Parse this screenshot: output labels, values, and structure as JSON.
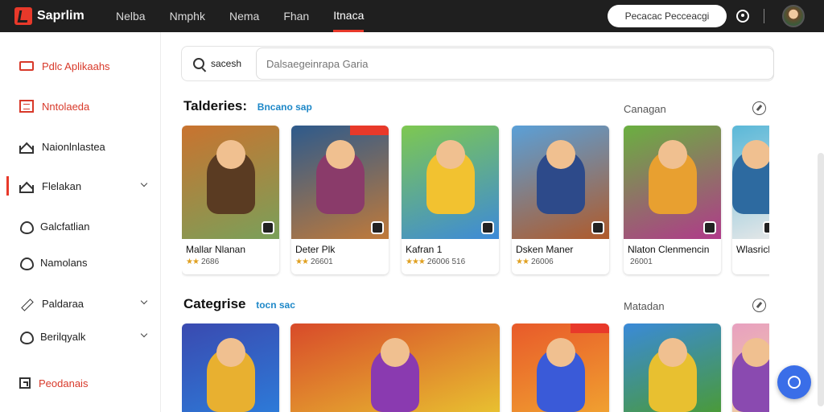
{
  "app": {
    "name": "Saprlim"
  },
  "topnav": {
    "items": [
      "Nelba",
      "Nmphk",
      "Nema",
      "Fhan",
      "Itnaca"
    ],
    "active_index": 4
  },
  "topbar": {
    "search_label": "Pecacac Pecceacgi"
  },
  "sidebar": {
    "items": [
      {
        "label": "Pdlc Aplikaahs",
        "icon": "monitor-icon",
        "color": "#d8392a",
        "chevron": false
      },
      {
        "label": "Nntolaeda",
        "icon": "list-icon",
        "color": "#d8392a",
        "chevron": false
      },
      {
        "label": "Naionlnlastea",
        "icon": "home-icon",
        "color": "#222222",
        "chevron": false
      },
      {
        "label": "Flelakan",
        "icon": "home-icon",
        "color": "#222222",
        "chevron": true,
        "current": true
      },
      {
        "label": "Galcfatlian",
        "icon": "heart-icon",
        "color": "#222222",
        "chevron": false
      },
      {
        "label": "Namolans",
        "icon": "heart-icon",
        "color": "#222222",
        "chevron": false
      },
      {
        "label": "Paldaraa",
        "icon": "pencil-icon",
        "color": "#222222",
        "chevron": true
      },
      {
        "label": "Berilqyalk",
        "icon": "heart-icon",
        "color": "#222222",
        "chevron": true
      },
      {
        "label": "Peodanais",
        "icon": "box-icon",
        "color": "#d8392a",
        "chevron": false
      }
    ]
  },
  "search": {
    "label": "sacesh",
    "placeholder": "Dalsaegeinrapa Garia"
  },
  "section1": {
    "title": "Talderies:",
    "subtitle": "Bncano sap",
    "right_label": "Canagan",
    "cards": [
      {
        "name": "Mallar Nlanan",
        "stars": "★★",
        "meta": "2686",
        "colors": [
          "#c9732f",
          "#5a3b22",
          "#7aa05a"
        ],
        "tag": false
      },
      {
        "name": "Deter Plk",
        "stars": "★★",
        "meta": "26601",
        "colors": [
          "#2d5a8c",
          "#8a3b6a",
          "#c07a3a"
        ],
        "tag": true
      },
      {
        "name": "Kafran 1",
        "stars": "★★★",
        "meta": "26006 516",
        "colors": [
          "#7ec850",
          "#f2c230",
          "#3d8ad8"
        ],
        "tag": false
      },
      {
        "name": "Dsken Maner",
        "stars": "★★",
        "meta": "26006",
        "colors": [
          "#5aa0d8",
          "#2d4a8a",
          "#b05a2a"
        ],
        "tag": false
      },
      {
        "name": "Nlaton Clenmencin",
        "stars": "",
        "meta": "26001",
        "colors": [
          "#6ab040",
          "#e8a030",
          "#b03a8a"
        ],
        "tag": false
      },
      {
        "name": "Wlasrich",
        "stars": "",
        "meta": "",
        "colors": [
          "#5ab8d8",
          "#2d6aa0",
          "#e8e8e8"
        ],
        "tag": false
      }
    ]
  },
  "section2": {
    "title": "Categrise",
    "subtitle": "tocn sac",
    "right_label": "Matadan",
    "cards": [
      {
        "name": "",
        "colors": [
          "#3a4ab0",
          "#e8b030",
          "#2d7ad8"
        ],
        "tag": false
      },
      {
        "name": "",
        "colors": [
          "#d84a2a",
          "#8a3ab0",
          "#e8c030"
        ],
        "tag": false,
        "wide": true
      },
      {
        "name": "",
        "colors": [
          "#e85a2a",
          "#3a5ad8",
          "#f0a030"
        ],
        "tag": true
      },
      {
        "name": "",
        "colors": [
          "#3a8ad8",
          "#e8c030",
          "#4a9a3a"
        ],
        "tag": false
      },
      {
        "name": "",
        "colors": [
          "#e8a0c0",
          "#8a4ab0",
          "#f0d0a0"
        ],
        "tag": false
      }
    ]
  }
}
